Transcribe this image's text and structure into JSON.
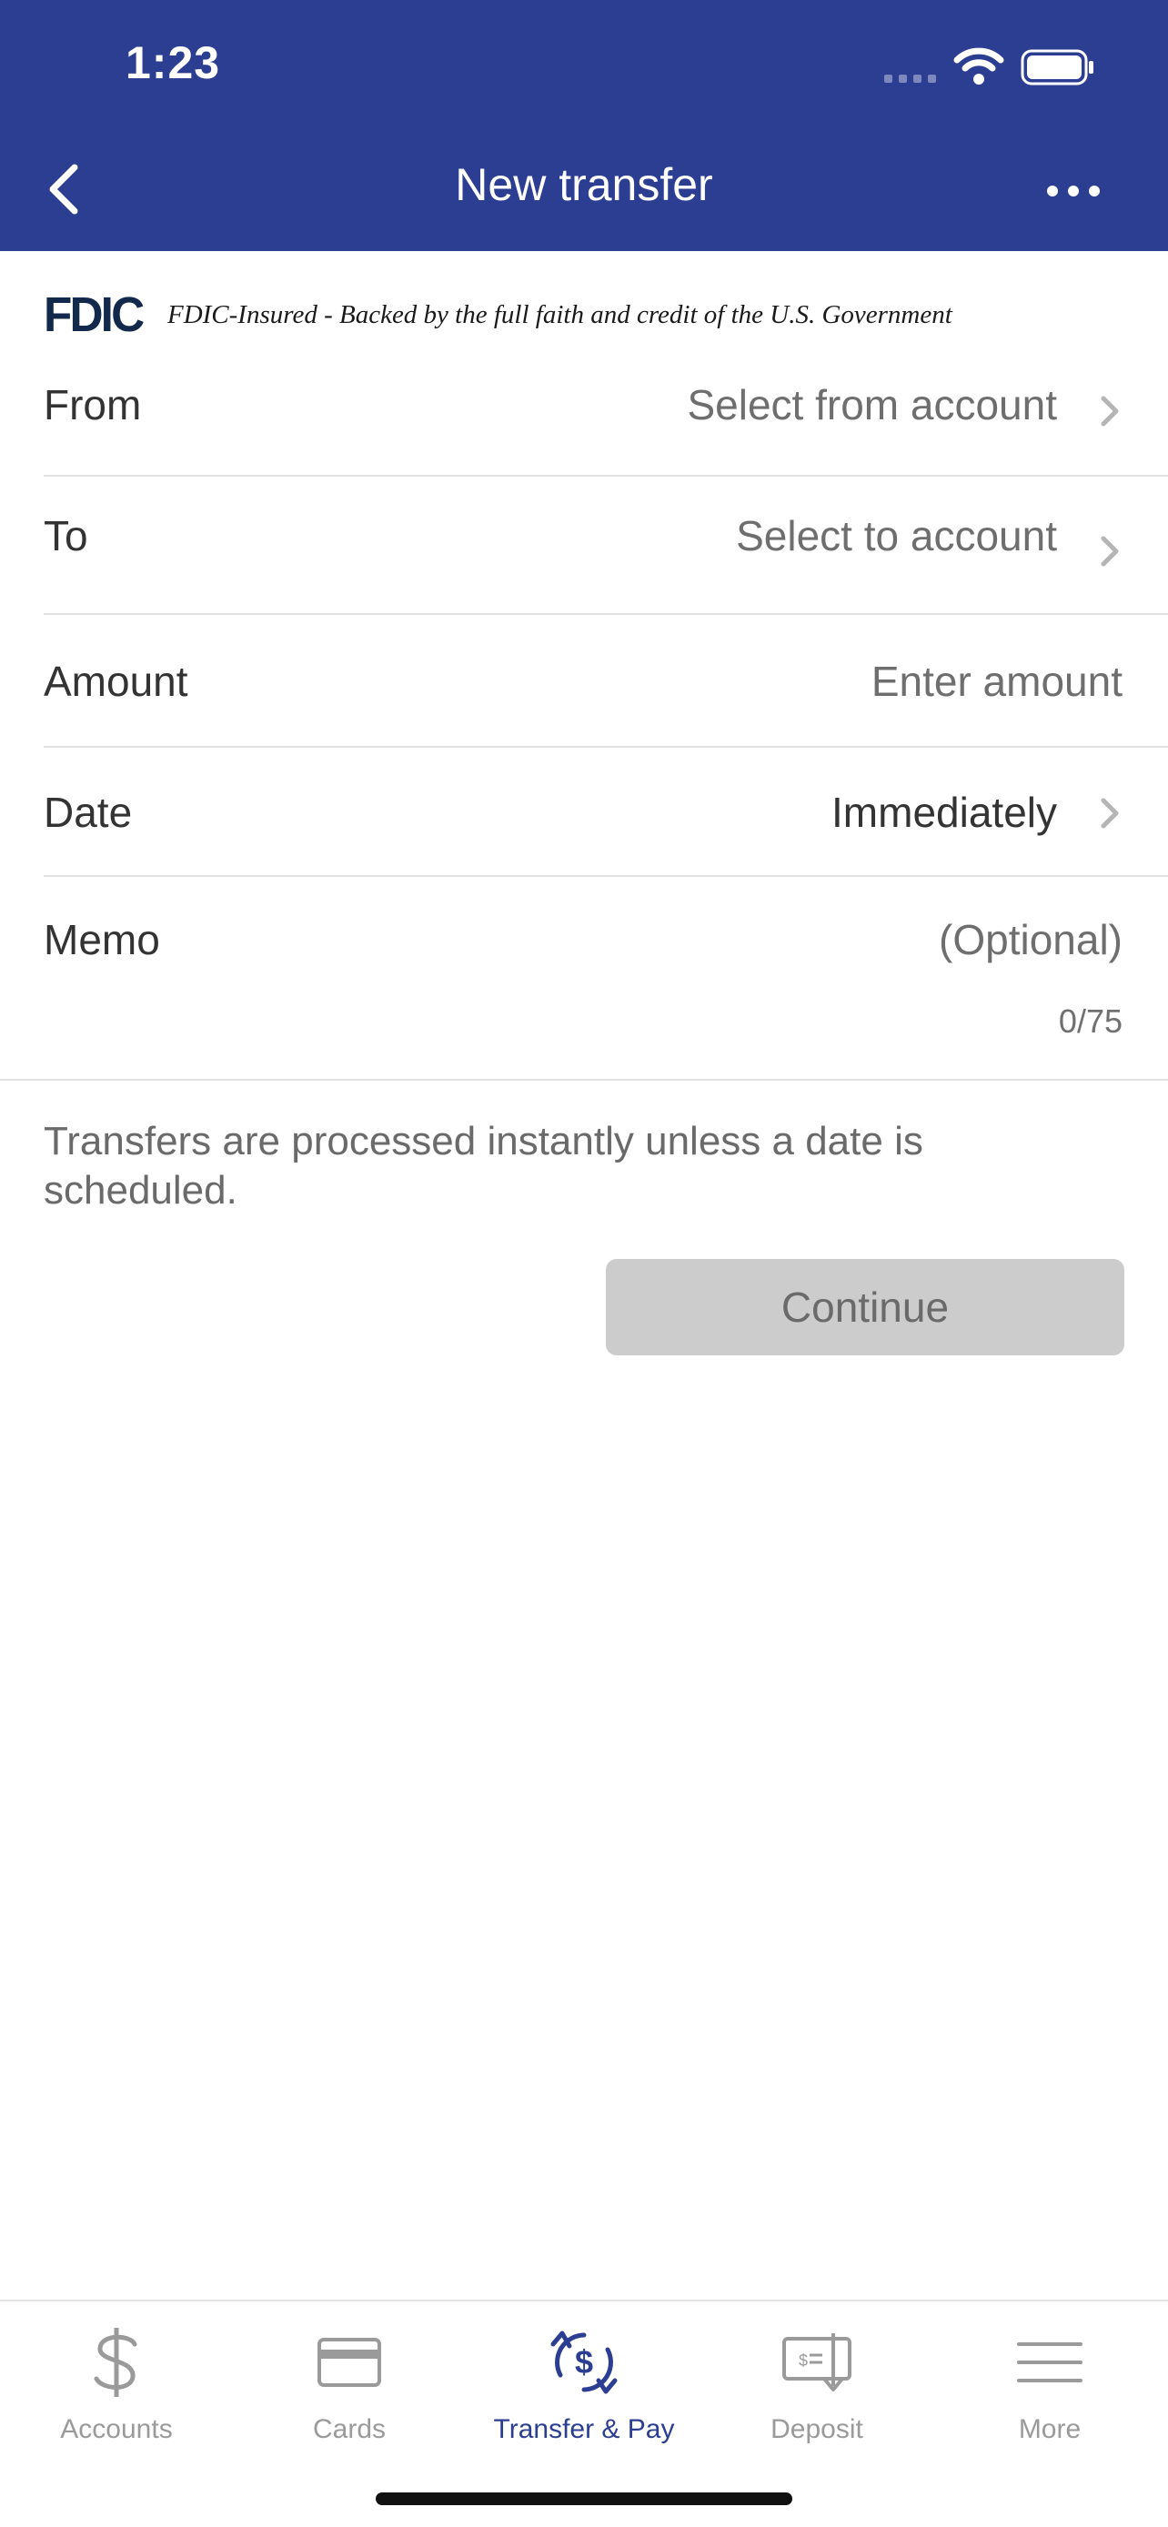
{
  "status_bar": {
    "time": "1:23"
  },
  "header": {
    "title": "New transfer"
  },
  "fdic": {
    "logo": "FDIC",
    "text": "FDIC-Insured - Backed by the full faith and credit of the U.S. Government"
  },
  "form": {
    "from": {
      "label": "From",
      "placeholder": "Select from account"
    },
    "to": {
      "label": "To",
      "placeholder": "Select to account"
    },
    "amount": {
      "label": "Amount",
      "placeholder": "Enter amount"
    },
    "date": {
      "label": "Date",
      "value": "Immediately"
    },
    "memo": {
      "label": "Memo",
      "placeholder": "(Optional)",
      "counter": "0/75"
    }
  },
  "helper_text": "Transfers are processed instantly unless a date is scheduled.",
  "continue_label": "Continue",
  "tabs": [
    {
      "label": "Accounts",
      "icon": "dollar-icon",
      "active": false
    },
    {
      "label": "Cards",
      "icon": "card-icon",
      "active": false
    },
    {
      "label": "Transfer & Pay",
      "icon": "transfer-pay-icon",
      "active": true
    },
    {
      "label": "Deposit",
      "icon": "check-deposit-icon",
      "active": false
    },
    {
      "label": "More",
      "icon": "hamburger-menu-icon",
      "active": false
    }
  ],
  "colors": {
    "brand": "#2c3e92",
    "inactive_tab": "#9a9a9a",
    "button_disabled": "#cccccc"
  }
}
